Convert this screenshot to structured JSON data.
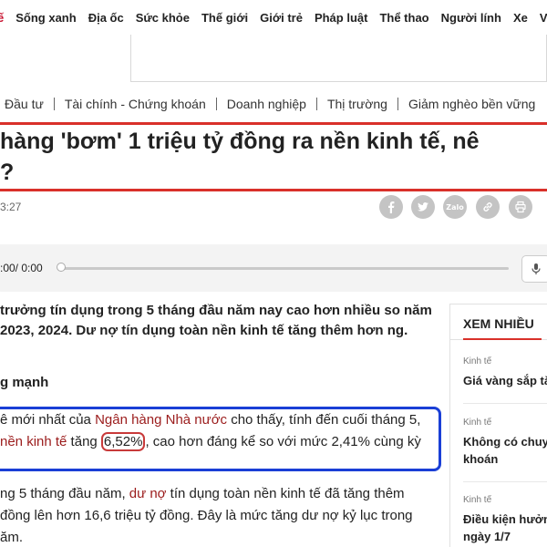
{
  "topnav": [
    "ế",
    "Sống xanh",
    "Địa ốc",
    "Sức khỏe",
    "Thế giới",
    "Giới trẻ",
    "Pháp luật",
    "Thể thao",
    "Người lính",
    "Xe",
    "Văn"
  ],
  "subnav": [
    "Đầu tư",
    "Tài chính - Chứng khoán",
    "Doanh nghiệp",
    "Thị trường",
    "Giảm nghèo bền vững"
  ],
  "article": {
    "title_line1": "hàng 'bơm' 1 triệu tỷ đồng ra nền kinh tế, nê",
    "title_line2": "?",
    "time": "3:27",
    "player_time": ":00/ 0:00",
    "sapo": "trưởng tín dụng trong 5 tháng đầu năm nay cao hơn nhiều so năm 2023, 2024. Dư nợ tín dụng toàn nền kinh tế tăng thêm hơn ng.",
    "subhead": "g mạnh",
    "para1_a": "ê mới nhất của ",
    "para1_link": "Ngân hàng Nhà nước",
    "para1_b": " cho thấy, tính đến cuối tháng 5,",
    "para1_c_link": "nền kinh tế",
    "para1_d": " tăng ",
    "para1_value": "6,52%",
    "para1_e": ", cao hơn đáng kể so với mức 2,41% cùng kỳ",
    "para2_a": "ng 5 tháng đầu năm, ",
    "para2_link": "dư nợ",
    "para2_b": " tín dụng toàn nền kinh tế đã tăng thêm",
    "para2_c": " đồng lên hơn 16,6 triệu tỷ đồng. Đây là mức tăng dư nợ kỷ lục trong",
    "para2_d": "ăm."
  },
  "share": {
    "icons": [
      "facebook-icon",
      "twitter-icon",
      "zalo-icon",
      "link-icon",
      "print-icon"
    ],
    "zalo_label": "Zalo"
  },
  "sidebar": {
    "title": "XEM NHIỀU",
    "items": [
      {
        "category": "Kinh tế",
        "headline": "Giá vàng sắp tă"
      },
      {
        "category": "Kinh tế",
        "headline_line1": "Không có chuy",
        "headline_line2": "khoán"
      },
      {
        "category": "Kinh tế",
        "headline_line1": "Điều kiện hưởn",
        "headline_line2": "ngày 1/7"
      }
    ]
  },
  "colors": {
    "accent_red": "#d9302a",
    "highlight_blue": "#1a3fd6",
    "link_red": "#9b1c1c"
  }
}
